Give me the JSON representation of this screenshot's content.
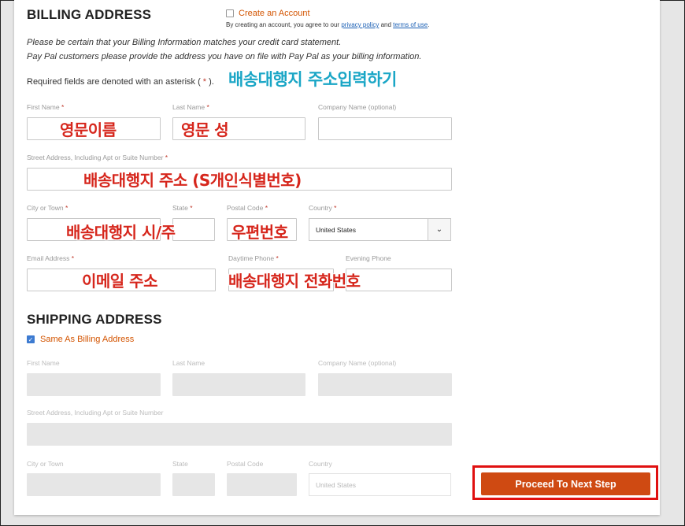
{
  "billing": {
    "heading": "BILLING ADDRESS",
    "create_account": "Create an Account",
    "account_note_prefix": "By creating an account, you agree to our",
    "privacy_link": "privacy policy",
    "and": "and",
    "terms_link": "terms of use",
    "period": ".",
    "notice_1": "Please be certain that your Billing Information matches your credit card statement.",
    "notice_2": "Pay Pal customers please provide the address you have on file with Pay Pal as your billing information.",
    "required_prefix": "Required fields are denoted with an asterisk (",
    "required_star": " * ",
    "required_suffix": ").",
    "labels": {
      "first_name": "First Name",
      "last_name": "Last Name",
      "company": "Company Name (optional)",
      "street": "Street Address, Including Apt or Suite Number",
      "city": "City or Town",
      "state": "State",
      "postal": "Postal Code",
      "country": "Country",
      "email": "Email Address",
      "day_phone": "Daytime Phone",
      "eve_phone": "Evening Phone"
    },
    "required_mark": "*",
    "country_value": "United States"
  },
  "annotations": {
    "title": "배송대행지 주소입력하기",
    "first_name": "영문이름",
    "last_name": "영문 성",
    "street": "배송대행지 주소   (S개인식별번호)",
    "city_state": "배송대행지 시/주",
    "postal": "우편번호",
    "email": "이메일 주소",
    "phone": "배송대행지 전화번호"
  },
  "shipping": {
    "heading": "SHIPPING ADDRESS",
    "same_as_billing": "Same As Billing Address",
    "same_as_billing_checked": true,
    "labels": {
      "first_name": "First Name",
      "last_name": "Last Name",
      "company": "Company Name (optional)",
      "street": "Street Address, Including Apt or Suite Number",
      "city": "City or Town",
      "state": "State",
      "postal": "Postal Code",
      "country": "Country"
    },
    "country_value": "United States"
  },
  "actions": {
    "proceed": "Proceed To Next Step"
  },
  "colors": {
    "accent": "#cf4a12",
    "annotation_red": "#d6261c",
    "annotation_cyan": "#1aa6c6",
    "highlight_box": "#e01010"
  }
}
